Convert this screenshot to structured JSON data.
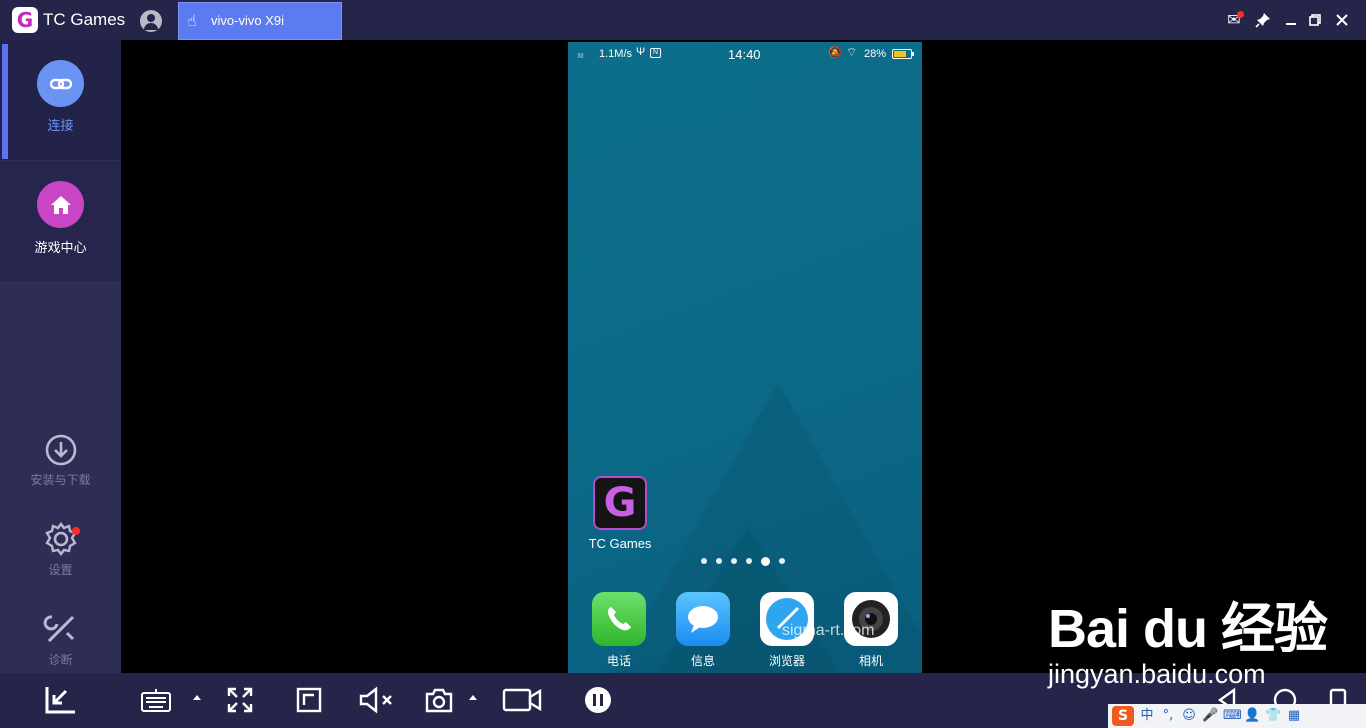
{
  "titlebar": {
    "app_title": "TC Games",
    "logo_glyph": "G",
    "account_icon": "user-avatar-icon",
    "device_tab": "vivo-vivo X9i",
    "controls": [
      "mail-icon",
      "pin-icon",
      "minimize-icon",
      "restore-icon",
      "close-icon"
    ]
  },
  "sidebar": {
    "nav": [
      {
        "label": "连接",
        "icon": "link-icon",
        "active": true
      },
      {
        "label": "游戏中心",
        "icon": "home-icon",
        "active": false
      }
    ],
    "tools": [
      {
        "label": "安装与下载",
        "icon": "download-icon"
      },
      {
        "label": "设置",
        "icon": "gear-icon",
        "badge": true
      },
      {
        "label": "诊断",
        "icon": "wrench-screwdriver-icon"
      }
    ],
    "collapse_icon": "collapse-arrow-icon"
  },
  "phone": {
    "status": {
      "signal": "ıııı",
      "net_speed": "1.1M/s",
      "usb": "Ψ",
      "nfc": "N",
      "time": "14:40",
      "mute": "🔕",
      "wifi": "⌔",
      "battery": "28%"
    },
    "desktop_app": {
      "label": "TC Games",
      "glyph": "G"
    },
    "page_dots": 6,
    "active_dot": 4,
    "dock": [
      {
        "label": "电话",
        "icon": "phone-icon"
      },
      {
        "label": "信息",
        "icon": "message-icon"
      },
      {
        "label": "浏览器",
        "icon": "compass-icon"
      },
      {
        "label": "相机",
        "icon": "camera-lens-icon"
      }
    ]
  },
  "toolbar": {
    "buttons": [
      "keyboard-icon",
      "fullscreen-icon",
      "fit-window-icon",
      "mute-icon",
      "screenshot-icon",
      "record-icon",
      "pause-icon"
    ],
    "nav_buttons": [
      "back-icon",
      "home-icon",
      "recents-icon"
    ]
  },
  "watermarks": {
    "baidu_brand": "Bai du 经验",
    "baidu_url": "jingyan.baidu.com",
    "sigma": "sigma-rt.com"
  },
  "ime": {
    "logo": "S",
    "items": [
      "中",
      "°,",
      "☺",
      "🎤",
      "⌨",
      "👤",
      "👕",
      "▦"
    ]
  },
  "colors": {
    "accent": "#5a73f0",
    "sidebar": "#2d2d55",
    "titlebar": "#25254a",
    "phone_bg": "#0b6a87",
    "badge": "#ff2b2b",
    "game_center": "#c845c6"
  }
}
